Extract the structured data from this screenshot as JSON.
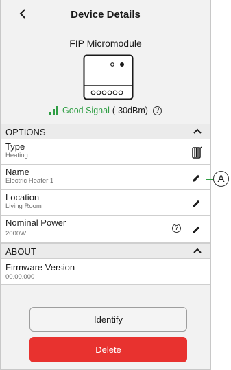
{
  "header": {
    "back_icon": "chevron-left-icon",
    "title": "Device Details"
  },
  "device": {
    "name": "FIP Micromodule",
    "image_icon": "micromodule-device-icon"
  },
  "signal": {
    "icon": "signal-bars-icon",
    "quality": "Good Signal",
    "value": "(-30dBm)",
    "help_icon": "question-circle-icon",
    "color": "#2f9e44"
  },
  "options": {
    "title": "OPTIONS",
    "chevron_icon": "chevron-up-icon",
    "rows": [
      {
        "label": "Type",
        "value": "Heating",
        "icon": "radiator-icon"
      },
      {
        "label": "Name",
        "value": "Electric Heater 1",
        "icon": "pencil-icon"
      },
      {
        "label": "Location",
        "value": "Living Room",
        "icon": "pencil-icon"
      },
      {
        "label": "Nominal Power",
        "value": "2000W",
        "icon": "pencil-icon",
        "help_icon": "question-circle-icon"
      }
    ]
  },
  "about": {
    "title": "ABOUT",
    "chevron_icon": "chevron-up-icon",
    "rows": [
      {
        "label": "Firmware Version",
        "value": "00.00.000"
      }
    ]
  },
  "buttons": {
    "identify": "Identify",
    "delete": "Delete",
    "delete_color": "#e8322f"
  },
  "callout": {
    "label": "A"
  }
}
